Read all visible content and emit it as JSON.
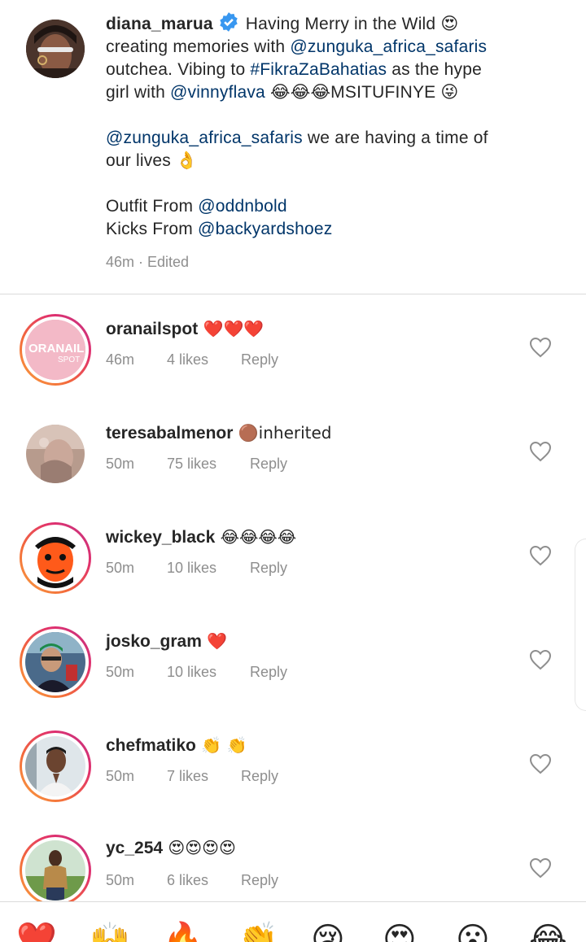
{
  "caption": {
    "username": "diana_marua",
    "verified_icon": "verified-badge-icon",
    "line1_text": "Having Merry in the Wild 😍",
    "line2_prefix": "creating memories with ",
    "line2_link": "@zunguka_africa_safaris",
    "line3_prefix": "outchea. Vibing to ",
    "line3_link": "#FikraZaBahatias",
    "line3_suffix": " as the hype",
    "line4_prefix": "girl with ",
    "line4_link": "@vinnyflava",
    "line4_suffix": " 😂😂😂MSITUFINYE 😜",
    "para2_link": "@zunguka_africa_safaris",
    "para2_text": " we are having a time of",
    "para2_line2": "our lives 👌",
    "outfit_prefix": "Outfit From ",
    "outfit_link": "@oddnbold",
    "kicks_prefix": "Kicks From ",
    "kicks_link": "@backyardshoez",
    "meta": "46m · Edited"
  },
  "comments": [
    {
      "username": "oranailspot",
      "text": " ❤️❤️❤️",
      "time": "46m",
      "likes": "4 likes",
      "reply": "Reply",
      "avatar_text": "ORANAIL",
      "avatar_text2": "SPOT"
    },
    {
      "username": "teresabalmenor",
      "text": " 🟤inherited",
      "time": "50m",
      "likes": "75 likes",
      "reply": "Reply"
    },
    {
      "username": "wickey_black",
      "text": " 😂😂😂😂",
      "time": "50m",
      "likes": "10 likes",
      "reply": "Reply"
    },
    {
      "username": "josko_gram",
      "text": " ❤️",
      "time": "50m",
      "likes": "10 likes",
      "reply": "Reply"
    },
    {
      "username": "chefmatiko",
      "text": " 👏 👏",
      "time": "50m",
      "likes": "7 likes",
      "reply": "Reply"
    },
    {
      "username": "yc_254",
      "text": " 😍😍😍😍",
      "time": "50m",
      "likes": "6 likes",
      "reply": "Reply"
    }
  ],
  "emoji_bar": [
    "❤️",
    "🙌",
    "🔥",
    "👏",
    "😢",
    "😍",
    "😮",
    "😂"
  ],
  "colors": {
    "link": "#003569",
    "meta_gray": "#8e8e8e",
    "story_ring_start": "#f9a03f",
    "story_ring_end": "#c13584",
    "verified_blue": "#3897f0"
  }
}
